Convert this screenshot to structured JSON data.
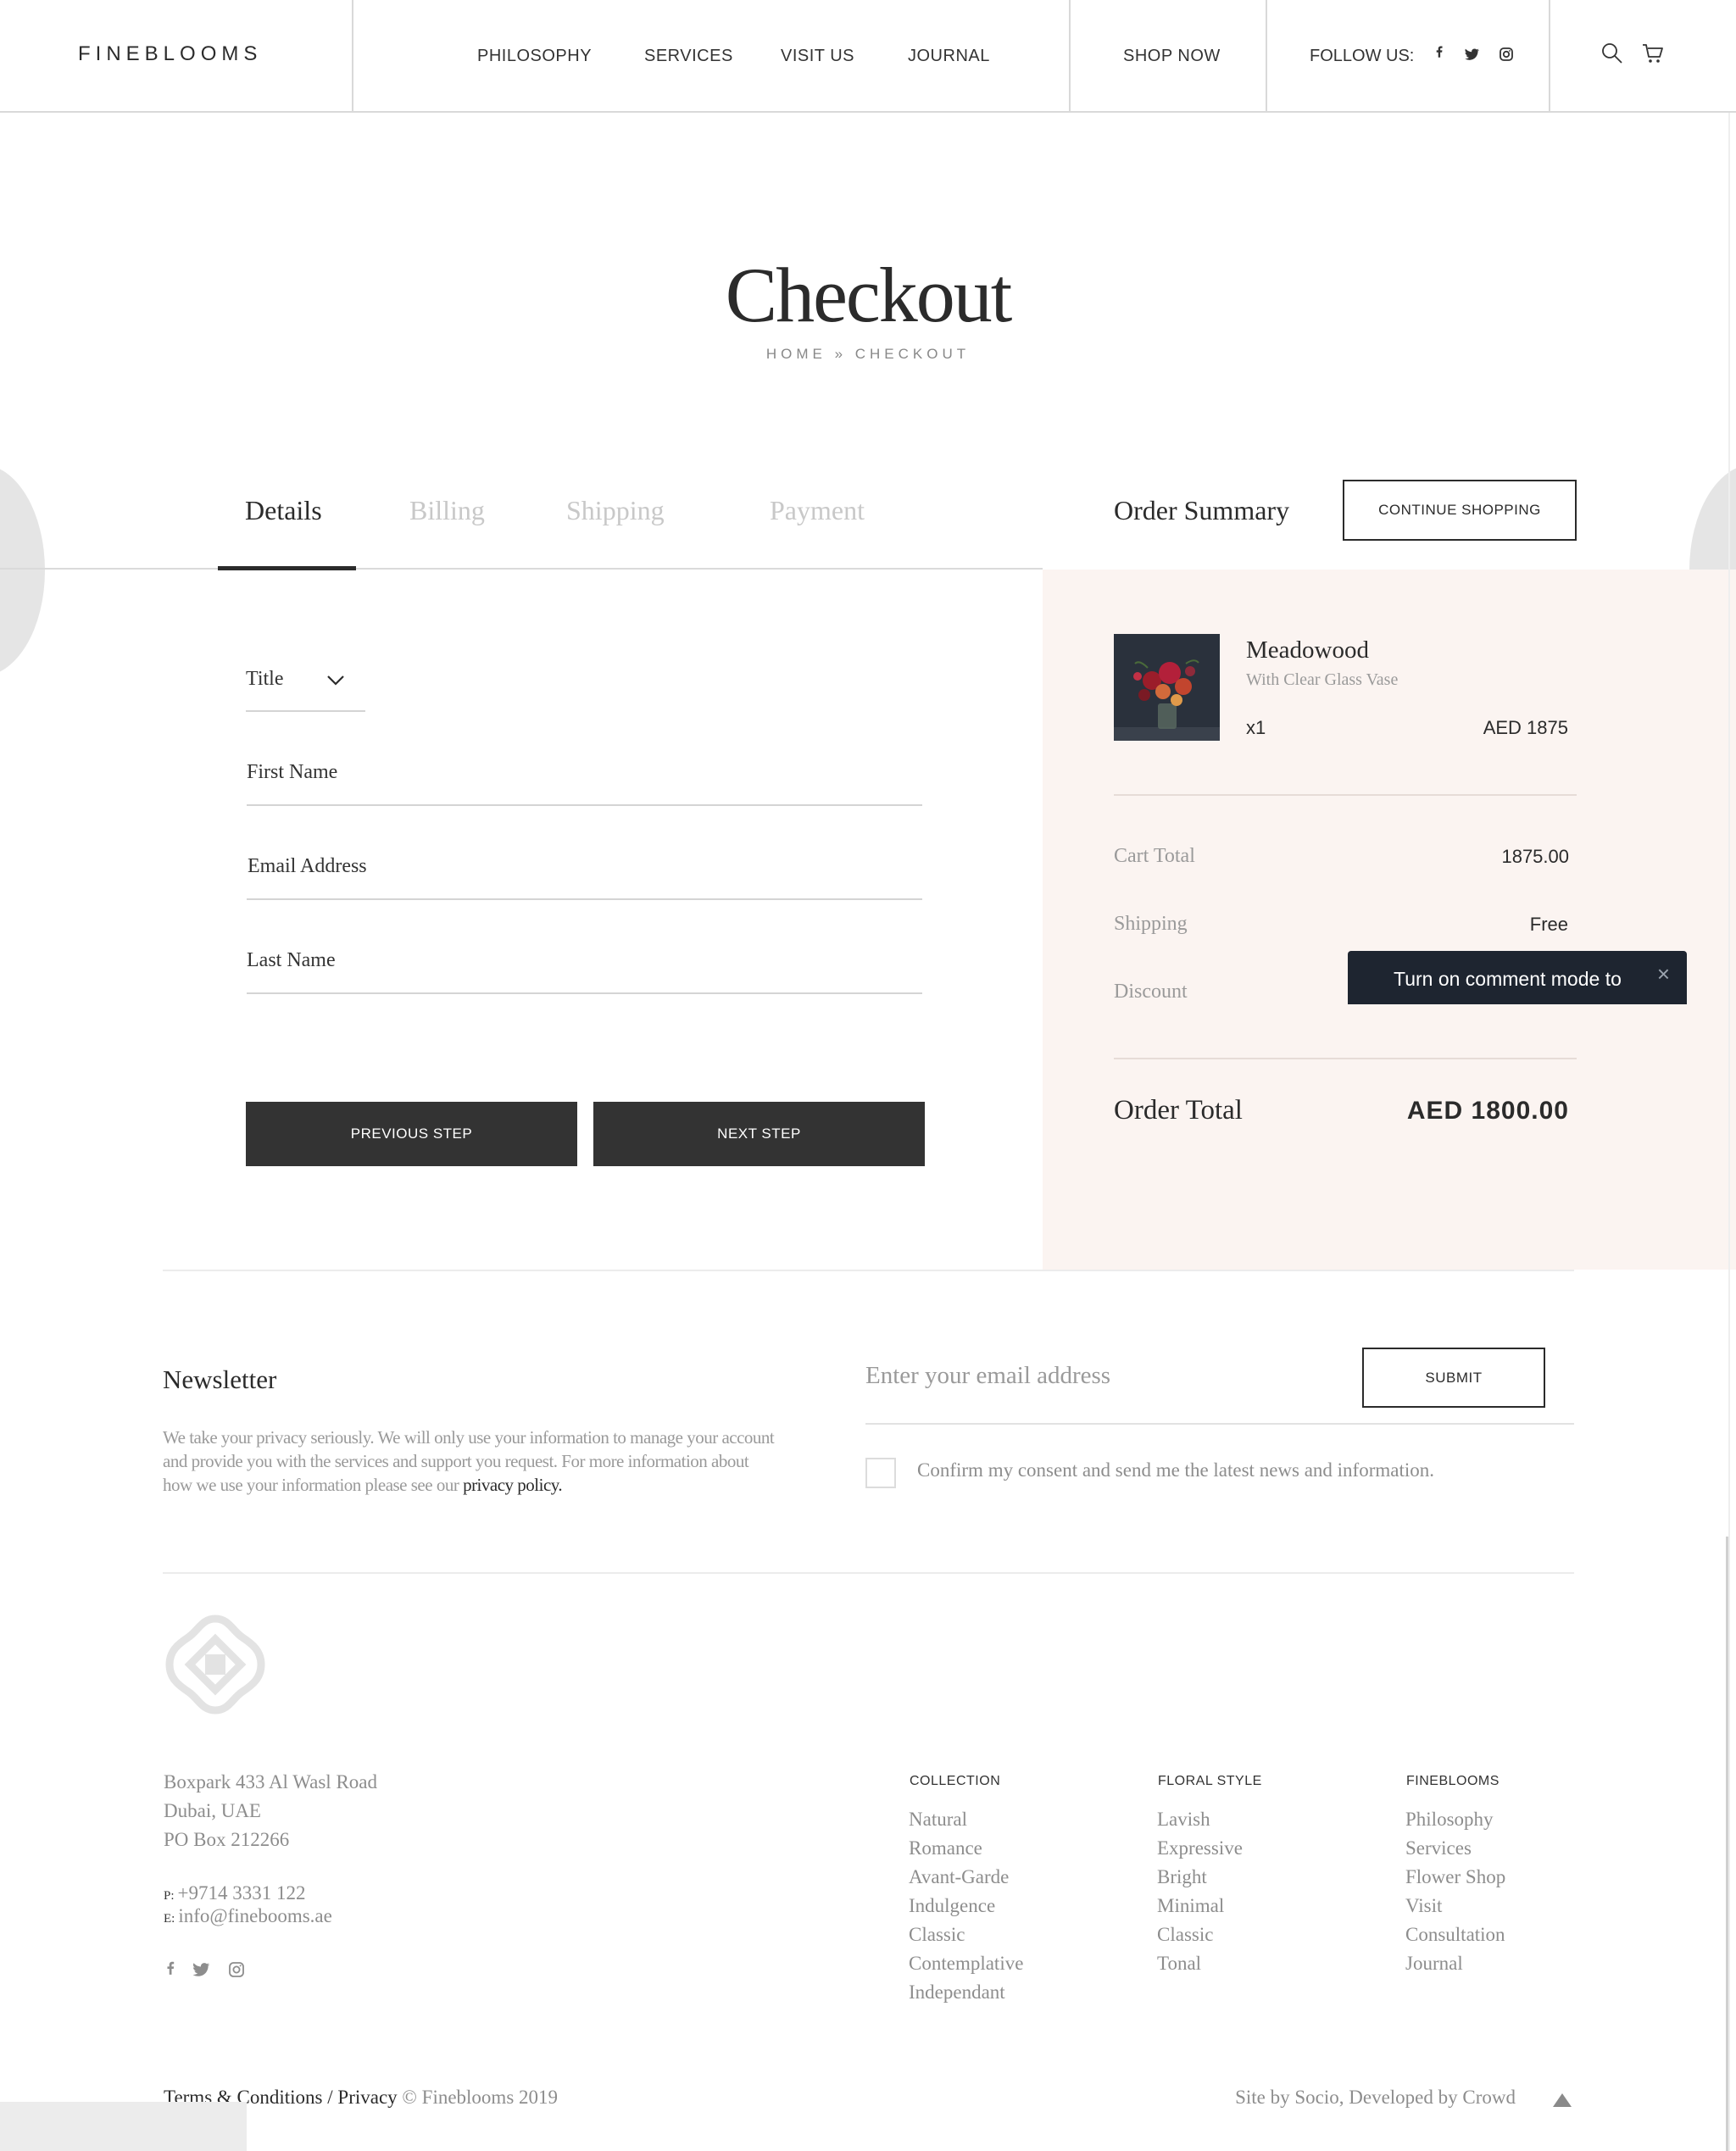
{
  "header": {
    "logo": "FINEBLOOMS",
    "nav": [
      "PHILOSOPHY",
      "SERVICES",
      "VISIT US",
      "JOURNAL"
    ],
    "shop_now": "SHOP NOW",
    "follow_label": "FOLLOW US:",
    "social_icons": [
      "facebook-icon",
      "twitter-icon",
      "instagram-icon"
    ],
    "action_icons": [
      "search-icon",
      "cart-icon"
    ]
  },
  "page": {
    "title": "Checkout",
    "breadcrumb": "HOME » CHECKOUT"
  },
  "steps": {
    "items": [
      "Details",
      "Billing",
      "Shipping",
      "Payment"
    ],
    "active": "Details"
  },
  "form": {
    "title_select": "Title",
    "first_name": "First Name",
    "email": "Email Address",
    "last_name": "Last Name",
    "prev_button": "PREVIOUS STEP",
    "next_button": "NEXT STEP"
  },
  "summary": {
    "title": "Order Summary",
    "continue_button": "CONTINUE SHOPPING",
    "product": {
      "name": "Meadowood",
      "variant": "With Clear Glass Vase",
      "qty": "x1",
      "price": "AED  1875"
    },
    "cart_total_label": "Cart Total",
    "cart_total_value": "1875.00",
    "shipping_label": "Shipping",
    "shipping_value": "Free",
    "discount_label": "Discount",
    "order_total_label": "Order Total",
    "order_total_value": "AED 1800.00"
  },
  "tooltip": {
    "text": "Turn on comment mode to",
    "close": "×"
  },
  "newsletter": {
    "title": "Newsletter",
    "body": "We take your privacy seriously. We will only use your information to manage your account and provide you with the services and support you request. For more information about how we use your information please see our",
    "privacy_link": "privacy policy.",
    "email_placeholder": "Enter your email address",
    "submit": "SUBMIT",
    "consent": "Confirm my consent and send me the latest news and information."
  },
  "footer": {
    "address": [
      "Boxpark  433 Al Wasl Road",
      "Dubai, UAE",
      "PO Box 212266"
    ],
    "phone_prefix": "P:",
    "phone": "+9714 3331 122",
    "email_prefix": "E:",
    "email": "info@finebooms.ae",
    "columns": [
      {
        "heading": "COLLECTION",
        "items": [
          "Natural",
          "Romance",
          "Avant-Garde",
          "Indulgence",
          "Classic",
          "Contemplative",
          "Independant"
        ]
      },
      {
        "heading": "FLORAL STYLE",
        "items": [
          "Lavish",
          "Expressive",
          "Bright",
          "Minimal",
          "Classic",
          "Tonal"
        ]
      },
      {
        "heading": "FINEBLOOMS",
        "items": [
          "Philosophy",
          "Services",
          "Flower Shop",
          "Visit",
          "Consultation",
          "Journal"
        ]
      }
    ],
    "terms": "Terms & Conditions",
    "separator": "/",
    "privacy": "Privacy",
    "copyright": "© Fineblooms 2019",
    "credits": "Site by Socio, Developed by Crowd"
  },
  "colors": {
    "summary_bg": "#fbf4f1",
    "dark_button": "#333333",
    "tooltip_bg": "#1e2530"
  }
}
